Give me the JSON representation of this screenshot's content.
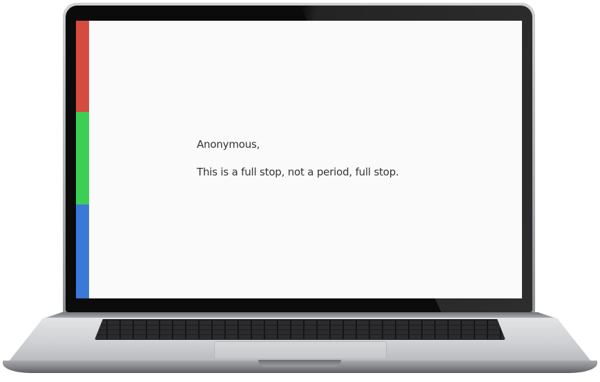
{
  "screen": {
    "message": {
      "salutation": "Anonymous,",
      "body": "This is a full stop, not a period, full stop."
    },
    "accent_colors": {
      "red": "#d64b3f",
      "green": "#3ccf55",
      "blue": "#3b78d8"
    }
  }
}
